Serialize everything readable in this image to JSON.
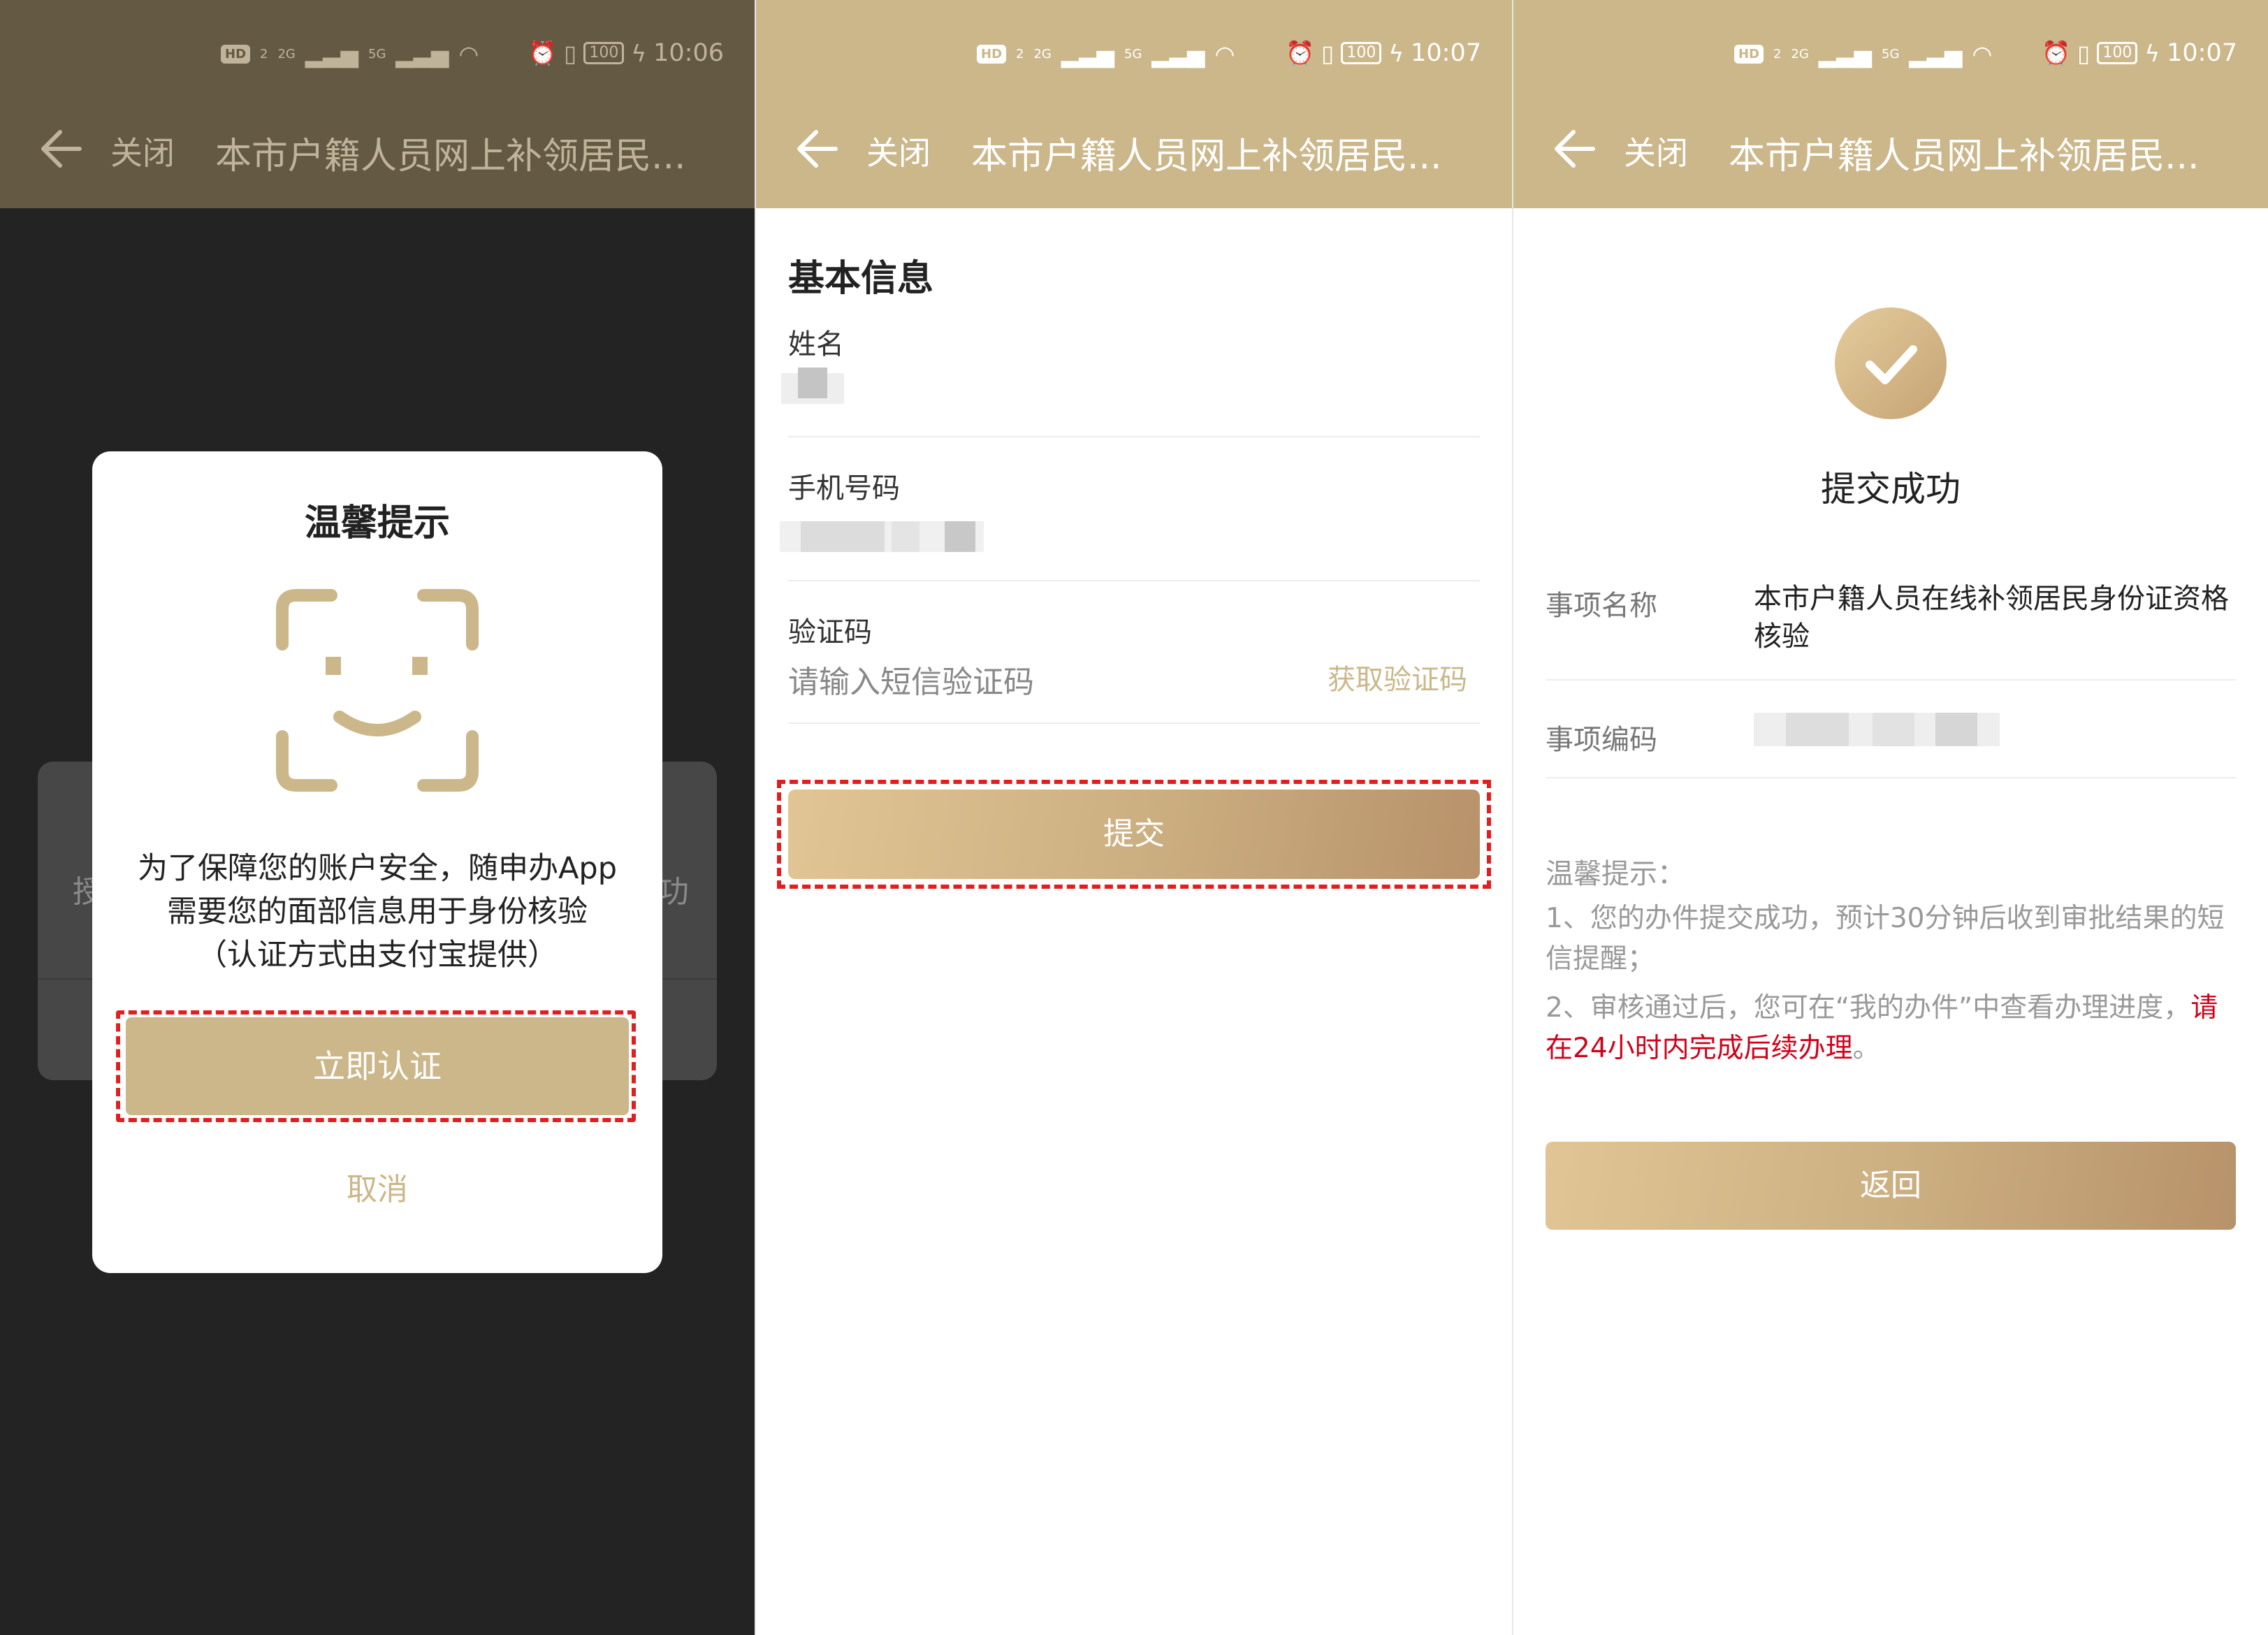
{
  "status_bar": {
    "badge": "HD",
    "sim": "2",
    "sig1": "2G",
    "sig2": "5G",
    "battery": "100"
  },
  "panels": [
    {
      "time": "10:06",
      "close_label": "关闭",
      "title": "本市户籍人员网上补领居民...",
      "bg_left": "授",
      "bg_right": "功",
      "dialog": {
        "title": "温馨提示",
        "line1": "为了保障您的账户安全，随申办App",
        "line2": "需要您的面部信息用于身份核验",
        "line3": "（认证方式由支付宝提供）",
        "confirm": "立即认证",
        "cancel": "取消"
      }
    },
    {
      "time": "10:07",
      "close_label": "关闭",
      "title": "本市户籍人员网上补领居民...",
      "section_title": "基本信息",
      "name_label": "姓名",
      "phone_label": "手机号码",
      "code_label": "验证码",
      "code_placeholder": "请输入短信验证码",
      "get_code": "获取验证码",
      "submit": "提交"
    },
    {
      "time": "10:07",
      "close_label": "关闭",
      "title": "本市户籍人员网上补领居民...",
      "success_text": "提交成功",
      "item_name_label": "事项名称",
      "item_name_value": "本市户籍人员在线补领居民身份证资格核验",
      "item_code_label": "事项编码",
      "tips_title": "温馨提示：",
      "tip1": "1、您的办件提交成功，预计30分钟后收到审批结果的短信提醒；",
      "tip2_prefix": "2、审核通过后，您可在“我的办件”中查看办理进度，",
      "tip2_red": "请在24小时内完成后续办理",
      "tip2_suffix": "。",
      "back_button": "返回"
    }
  ],
  "colors": {
    "gold": "#cbb78a",
    "dim_header": "#645a44",
    "highlight": "#e02020",
    "warning_text": "#d0021b"
  }
}
